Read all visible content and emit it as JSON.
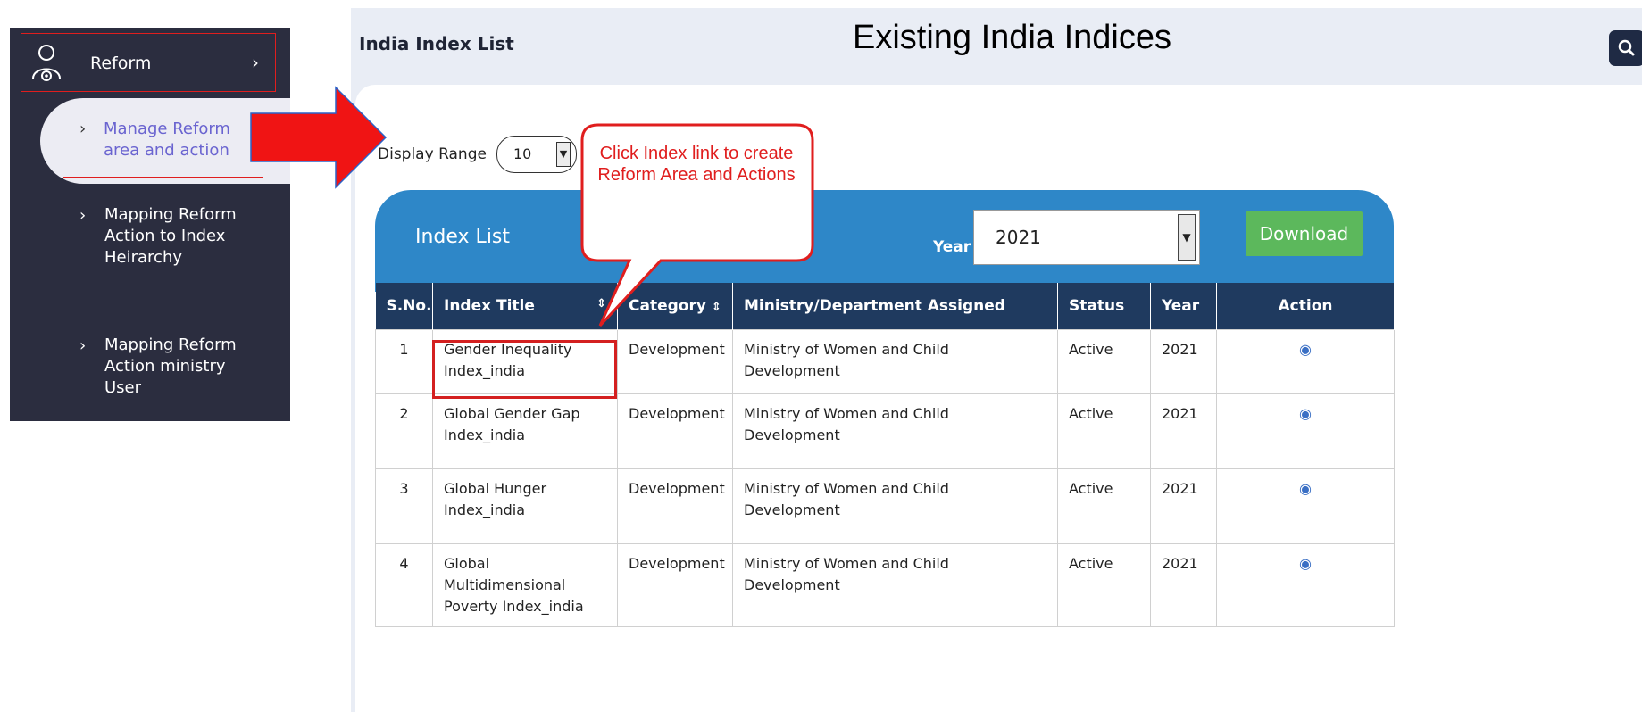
{
  "sidebar": {
    "reform_label": "Reform",
    "reform_chevron": "›",
    "active_item": "Manage Reform area and action",
    "items": [
      {
        "label": "Mapping Reform Action to Index Heirarchy"
      },
      {
        "label": "Mapping Reform Action ministry User"
      }
    ],
    "item_chevron": "›"
  },
  "header": {
    "title": "India Index List",
    "annotation_title": "Existing India Indices"
  },
  "controls": {
    "display_range_label": "Display Range",
    "display_range_value": "10"
  },
  "panel": {
    "title": "Index List",
    "year_label": "Year",
    "year_value": "2021",
    "download_label": "Download"
  },
  "table": {
    "headers": {
      "sno": "S.No.",
      "index_title": "Index Title",
      "category": "Category",
      "ministry": "Ministry/Department Assigned",
      "status": "Status",
      "year": "Year",
      "action": "Action"
    },
    "rows": [
      {
        "sno": "1",
        "title": "Gender Inequality Index_india",
        "category": "Development",
        "ministry": "Ministry of Women and Child Development",
        "status": "Active",
        "year": "2021"
      },
      {
        "sno": "2",
        "title": "Global Gender Gap Index_india",
        "category": "Development",
        "ministry": "Ministry of Women and Child Development",
        "status": "Active",
        "year": "2021"
      },
      {
        "sno": "3",
        "title": "Global Hunger Index_india",
        "category": "Development",
        "ministry": "Ministry of Women and Child Development",
        "status": "Active",
        "year": "2021"
      },
      {
        "sno": "4",
        "title": "Global Multidimensional Poverty Index_india",
        "category": "Development",
        "ministry": "Ministry of Women and Child Development",
        "status": "Active",
        "year": "2021"
      }
    ]
  },
  "annotation": {
    "callout": "Click Index link to create Reform Area and Actions"
  },
  "icons": {
    "search": "search-icon",
    "view": "eye-icon",
    "sort": "sort-icon",
    "reform": "user-gear-icon"
  },
  "colors": {
    "sidebar_bg": "#2b2d3f",
    "accent_blue": "#2e87c8",
    "table_header": "#1f3a5f",
    "download_green": "#5cb85c",
    "annotation_red": "#e01e1e",
    "active_green": "#2e9e2e",
    "link_blue": "#3a6fc4"
  }
}
